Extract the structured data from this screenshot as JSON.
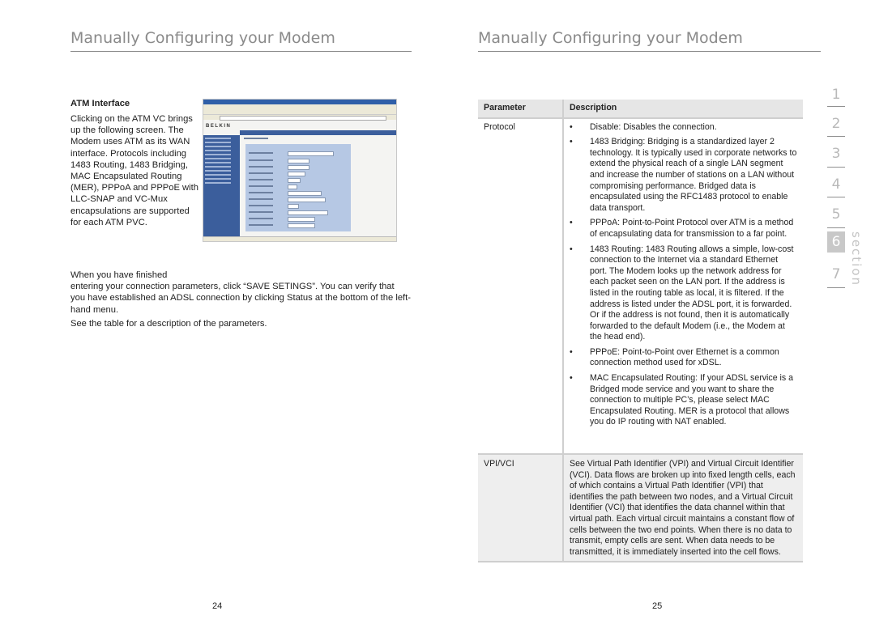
{
  "left_page": {
    "title": "Manually Configuring your Modem",
    "atm_heading": "ATM Interface",
    "atm_body": "Clicking on the ATM VC brings up the following screen. The   Modem uses ATM as its WAN interface. Protocols including 1483 Routing, 1483 Bridging, MAC Encapsulated Routing (MER), PPPoA and PPPoE with LLC-SNAP and VC-Mux encapsulations are supported for each ATM PVC.",
    "finish_line1": "When you have finished",
    "finish_rest": "entering your connection parameters, click “SAVE SETINGS”. You can verify that you have established an ADSL connection by clicking Status at the bottom of the left-hand menu.",
    "see_table": "See the table for a description of the parameters.",
    "screenshot": {
      "logo": "BELKIN",
      "caption": "ATM Interface configuration screen"
    },
    "page_number": "24"
  },
  "right_page": {
    "title": "Manually Configuring your Modem",
    "table": {
      "headers": [
        "Parameter",
        "Description"
      ],
      "rows": [
        {
          "parameter": "Protocol",
          "bullets": [
            "Disable: Disables the connection.",
            "1483 Bridging: Bridging is a standardized layer 2 technology. It is typically used in corporate networks to extend the physical reach of a single LAN segment and increase the number of stations on a LAN without compromising performance. Bridged data is encapsulated using the RFC1483 protocol to enable data transport.",
            "PPPoA: Point-to-Point Protocol over ATM is a method of encapsulating data for transmission to a far point.",
            "1483 Routing: 1483 Routing allows a simple, low-cost connection to the Internet via a standard Ethernet port. The Modem looks up the network address for each packet seen on the LAN port. If the address is listed in the routing table as local, it is filtered. If the address is listed under the ADSL port, it is forwarded. Or if the address is not found, then it is automatically forwarded to the default Modem (i.e., the   Modem at the head end).",
            "PPPoE: Point-to-Point over Ethernet is a common connection method used for xDSL.",
            "MAC Encapsulated Routing: If your ADSL service is a Bridged mode service and you want to share the connection to multiple PC’s, please select MAC Encapsulated Routing. MER is a protocol that allows you do IP routing with NAT enabled."
          ],
          "bullet_glyph": "•"
        },
        {
          "parameter": "VPI/VCI",
          "description": "See Virtual Path Identifier (VPI) and Virtual Circuit Identifier (VCI). Data flows are broken up into fixed length cells, each of which contains a Virtual Path Identifier (VPI) that identifies the path between two nodes, and a Virtual Circuit Identifier (VCI) that identifies the data channel within that virtual path. Each virtual circuit maintains a constant flow of cells between the two end points. When there is no data to transmit, empty cells are sent. When data needs to be transmitted, it is immediately inserted into the cell flows."
        }
      ]
    },
    "page_number": "25"
  },
  "section_nav": {
    "label": "section",
    "numbers": [
      "1",
      "2",
      "3",
      "4",
      "5",
      "6",
      "7"
    ],
    "active": "6"
  },
  "colors": {
    "title_gray": "#8a8a8a",
    "table_header_bg": "#e6e6e6",
    "vpi_row_bg": "#eeeeee",
    "section_active_bg": "#c8c8c8"
  }
}
